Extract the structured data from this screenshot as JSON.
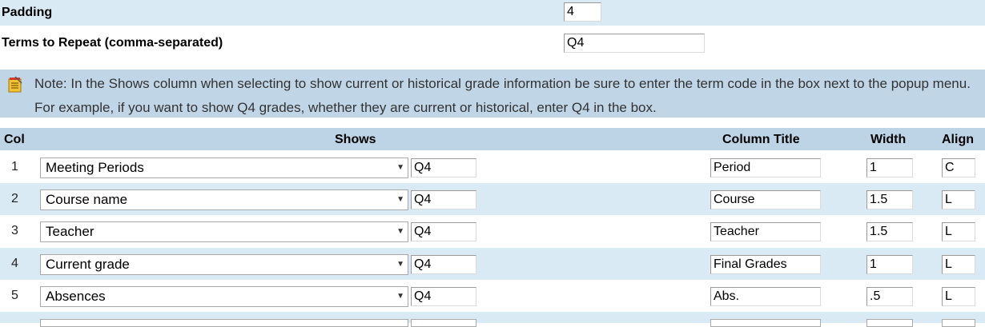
{
  "settings": {
    "padding": {
      "label": "Padding",
      "value": "4"
    },
    "terms_to_repeat": {
      "label": "Terms to Repeat (comma-separated)",
      "value": "Q4"
    }
  },
  "note": {
    "icon": "note-pad-icon",
    "text": "Note: In the Shows column when selecting to show current or historical grade information be sure to enter the term code in the box next to the popup menu. For example, if you want to show Q4 grades, whether they are current or historical, enter Q4 in the box."
  },
  "table": {
    "headers": {
      "col": "Col",
      "shows": "Shows",
      "column_title": "Column Title",
      "width": "Width",
      "align": "Align"
    },
    "rows": [
      {
        "col": "1",
        "shows": "Meeting Periods",
        "term": "Q4",
        "title": "Period",
        "width": "1",
        "align": "C"
      },
      {
        "col": "2",
        "shows": "Course name",
        "term": "Q4",
        "title": "Course",
        "width": "1.5",
        "align": "L"
      },
      {
        "col": "3",
        "shows": "Teacher",
        "term": "Q4",
        "title": "Teacher",
        "width": "1.5",
        "align": "L"
      },
      {
        "col": "4",
        "shows": "Current grade",
        "term": "Q4",
        "title": "Final Grades",
        "width": "1",
        "align": "L"
      },
      {
        "col": "5",
        "shows": "Absences",
        "term": "Q4",
        "title": "Abs.",
        "width": ".5",
        "align": "L"
      }
    ]
  },
  "colors": {
    "row_alt": "#d9eaf4",
    "note_bg": "#c0d5e6",
    "header_bg": "#bdd4e6"
  }
}
